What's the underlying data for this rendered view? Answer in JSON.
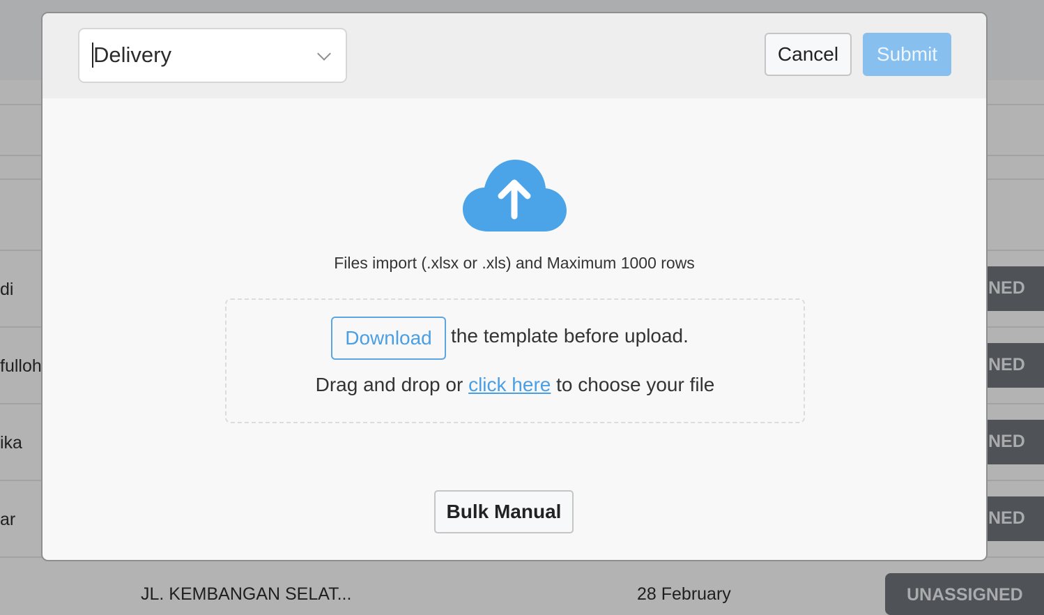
{
  "background": {
    "rows": [
      {
        "name_fragment": "di",
        "status_fragment": "NED"
      },
      {
        "name_fragment": "fulloh",
        "status_fragment": "NED"
      },
      {
        "name_fragment": "ika",
        "status_fragment": "NED"
      },
      {
        "name_fragment": "ar",
        "status_fragment": "NED"
      }
    ],
    "last_row": {
      "address": "JL. KEMBANGAN SELAT...",
      "date": "28 February",
      "status": "UNASSIGNED"
    }
  },
  "modal": {
    "type_select": {
      "value": "Delivery"
    },
    "cancel_label": "Cancel",
    "submit_label": "Submit",
    "upload_icon": "cloud-upload-icon",
    "info_text": "Files import (.xlsx or .xls) and Maximum 1000 rows",
    "download_label": "Download",
    "download_suffix": "the template before upload.",
    "drag_prefix": "Drag and drop or ",
    "click_here": "click here",
    "drag_suffix": " to choose your file",
    "bulk_manual_label": "Bulk Manual"
  },
  "colors": {
    "accent": "#4a9fe4",
    "submit_disabled": "#87bfee",
    "badge": "#4f5256"
  }
}
